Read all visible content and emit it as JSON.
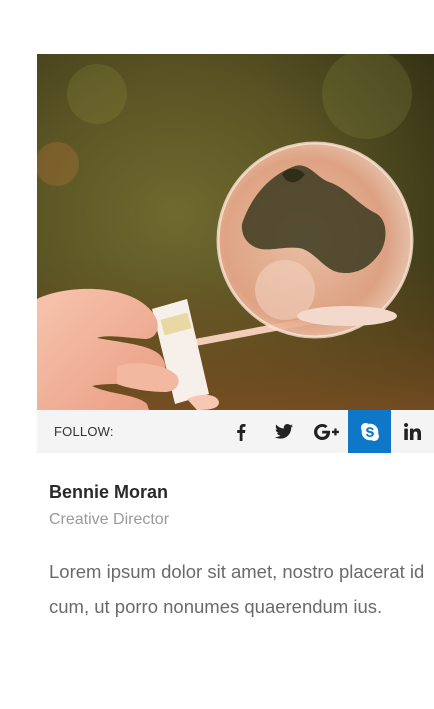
{
  "follow": {
    "label": "FOLLOW:",
    "items": [
      {
        "name": "facebook",
        "icon": "facebook-icon",
        "active": false
      },
      {
        "name": "twitter",
        "icon": "twitter-icon",
        "active": false
      },
      {
        "name": "google-plus",
        "icon": "google-plus-icon",
        "active": false
      },
      {
        "name": "skype",
        "icon": "skype-icon",
        "active": true
      },
      {
        "name": "linkedin",
        "icon": "linkedin-icon",
        "active": false
      }
    ],
    "active_color": "#0e77c8"
  },
  "profile": {
    "name": "Bennie Moran",
    "role": "Creative Director",
    "bio": "Lorem ipsum dolor sit amet, nostro placerat id cum, ut porro nonumes quaerendum ius."
  }
}
